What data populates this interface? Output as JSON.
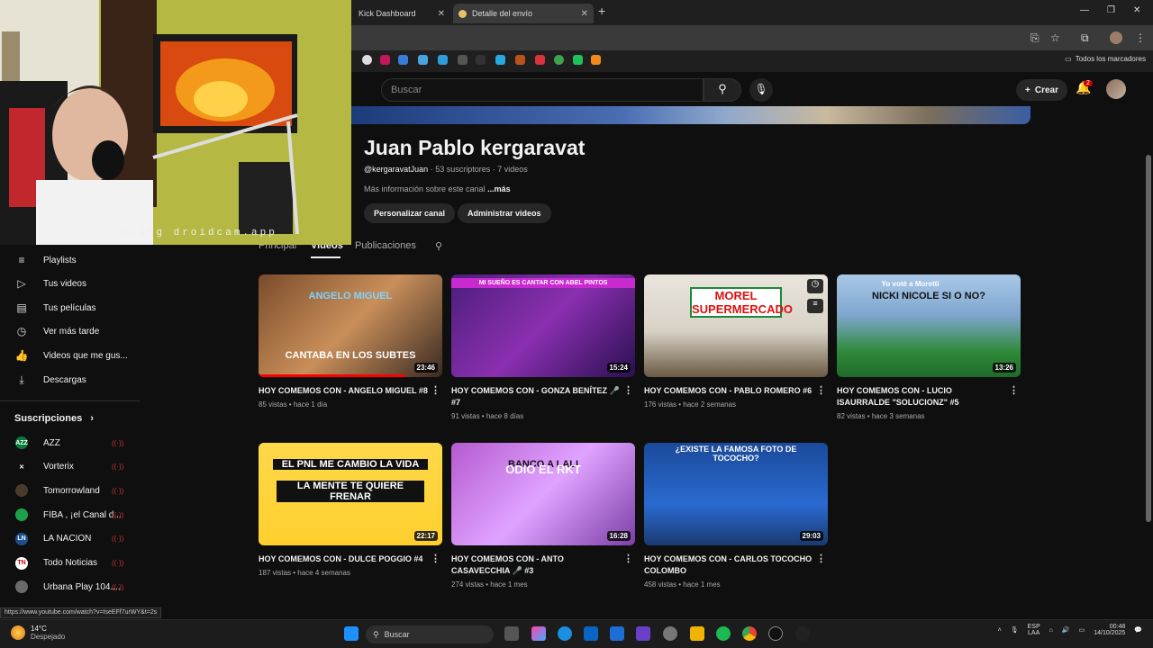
{
  "browser": {
    "tabs": [
      {
        "label": "Kick Dashboard"
      },
      {
        "label": "Detalle del envío"
      }
    ],
    "bookmarks_all": "Todos los marcadores",
    "status_url": "https://www.youtube.com/watch?v=IseEFf7urWY&t=2s"
  },
  "webcam": {
    "overlay_text": "using droidcam.app"
  },
  "header": {
    "search_placeholder": "Buscar",
    "create_label": "Crear",
    "notifications_count": "2"
  },
  "channel": {
    "name": "Juan Pablo kergaravat",
    "handle": "@kergaravatJuan",
    "subscribers": "53 suscriptores",
    "videos_count": "7 videos",
    "more_info": "Más información sobre este canal",
    "more_link": "...más",
    "customize_button": "Personalizar canal",
    "manage_button": "Administrar videos",
    "tabs": [
      "Principal",
      "Videos",
      "Publicaciones"
    ],
    "active_tab": "Videos"
  },
  "sidebar": {
    "items": [
      {
        "label": "Playlists",
        "icon": "playlist-icon"
      },
      {
        "label": "Tus videos",
        "icon": "video-icon"
      },
      {
        "label": "Tus películas",
        "icon": "film-icon"
      },
      {
        "label": "Ver más tarde",
        "icon": "clock-icon"
      },
      {
        "label": "Videos que me gus...",
        "icon": "thumbs-up-icon"
      },
      {
        "label": "Descargas",
        "icon": "download-icon"
      }
    ],
    "subscriptions_title": "Suscripciones",
    "subscriptions": [
      {
        "label": "AZZ",
        "color": "#0a7a3a",
        "abbr": "AZZ"
      },
      {
        "label": "Vorterix",
        "color": "#0f0f0f",
        "abbr": "✕"
      },
      {
        "label": "Tomorrowland",
        "color": "#4a3a2a",
        "abbr": ""
      },
      {
        "label": "FIBA , ¡el Canal d...",
        "color": "#1aa14a",
        "abbr": ""
      },
      {
        "label": "LA NACION",
        "color": "#1d4f8f",
        "abbr": "LN"
      },
      {
        "label": "Todo Noticias",
        "color": "#ffffff",
        "abbr": "TN"
      },
      {
        "label": "Urbana Play 104....",
        "color": "#6a6a6a",
        "abbr": ""
      }
    ]
  },
  "videos": [
    {
      "title": "HOY COMEMOS CON - ANGELO MIGUEL #8",
      "views": "85 vistas",
      "age": "hace 1 día",
      "duration": "23:46",
      "thumb_text": "CANTABA EN LOS SUBTES",
      "thumb_top": "ANGELO MIGUEL",
      "progress": 0.8
    },
    {
      "title": "HOY COMEMOS CON - GONZA BENÍTEZ 🎤 #7",
      "views": "91 vistas",
      "age": "hace 8 días",
      "duration": "15:24",
      "thumb_text": "MI SUEÑO ES CANTAR CON ABEL PINTOS",
      "thumb_top": "",
      "progress": 0
    },
    {
      "title": "HOY COMEMOS CON - PABLO ROMERO #6",
      "views": "176 vistas",
      "age": "hace 2 semanas",
      "duration": "",
      "thumb_text": "MOREL SUPERMERCADO",
      "thumb_top": "",
      "progress": 0
    },
    {
      "title": "HOY COMEMOS CON - LUCIO ISAURRALDE \"SOLUCIONZ\" #5",
      "views": "82 vistas",
      "age": "hace 3 semanas",
      "duration": "13:26",
      "thumb_text": "Yo voté a Moretti",
      "thumb_top": "NICKI NICOLE SI O NO?",
      "progress": 0
    },
    {
      "title": "HOY COMEMOS CON - DULCE POGGIO #4",
      "views": "187 vistas",
      "age": "hace 4 semanas",
      "duration": "22:17",
      "thumb_text": "EL PNL ME CAMBIO LA VIDA",
      "thumb_top": "LA MENTE TE QUIERE FRENAR",
      "progress": 0
    },
    {
      "title": "HOY COMEMOS CON - ANTO CASAVECCHIA 🎤 #3",
      "views": "274 vistas",
      "age": "hace 1 mes",
      "duration": "16:28",
      "thumb_text": "ODIO EL RKT",
      "thumb_top": "BANCO A LALI",
      "progress": 0
    },
    {
      "title": "HOY COMEMOS CON - CARLOS TOCOCHO COLOMBO",
      "views": "458 vistas",
      "age": "hace 1 mes",
      "duration": "29:03",
      "thumb_text": "¿EXISTE LA FAMOSA FOTO DE TOCOCHO?",
      "thumb_top": "",
      "progress": 0
    }
  ],
  "taskbar": {
    "temperature": "14°C",
    "weather": "Despejado",
    "search_label": "Buscar",
    "lang": "ESP",
    "region": "LAA",
    "time": "00:48",
    "date": "14/10/2025"
  },
  "colors": {
    "accent": "#ff0000",
    "background": "#0f0f0f",
    "pill": "#272727"
  }
}
